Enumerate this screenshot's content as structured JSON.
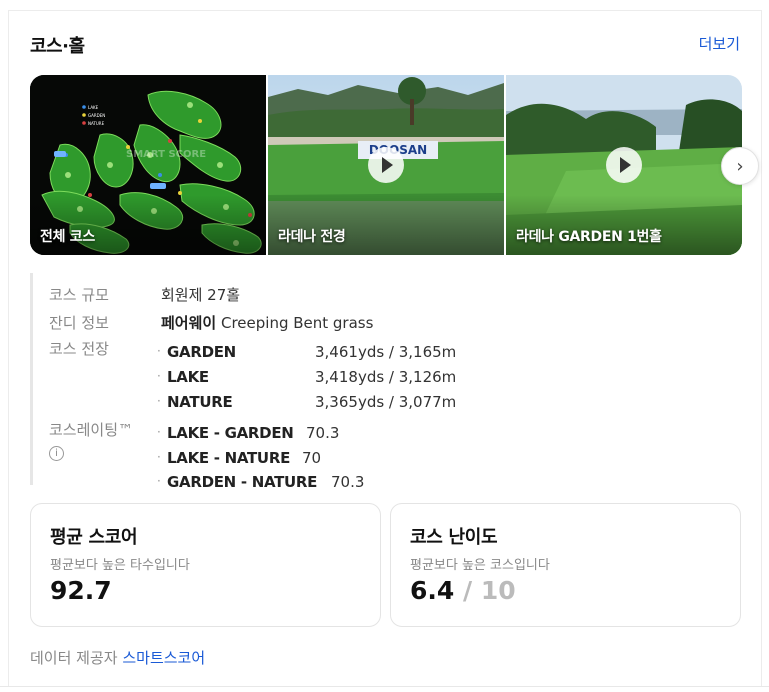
{
  "header": {
    "title": "코스·홀",
    "more_label": "더보기"
  },
  "media": [
    {
      "label": "전체 코스",
      "type": "map",
      "map_labels": [
        "LAKE",
        "GARDEN",
        "NATURE",
        "SMART SCORE"
      ]
    },
    {
      "label": "라데나 전경",
      "type": "video",
      "sign_text": "DOOSAN"
    },
    {
      "label": "라데나 GARDEN 1번홀",
      "type": "video"
    }
  ],
  "info": {
    "size_label": "코스 규모",
    "size_value": "회원제 27홀",
    "grass_label": "잔디 정보",
    "grass_bold": "페어웨이",
    "grass_value": "Creeping Bent grass",
    "length_label": "코스 전장",
    "lengths": [
      {
        "name": "GARDEN",
        "value": "3,461yds / 3,165m"
      },
      {
        "name": "LAKE",
        "value": "3,418yds / 3,126m"
      },
      {
        "name": "NATURE",
        "value": "3,365yds / 3,077m"
      }
    ],
    "rating_label": "코스레이팅™",
    "rating_info_icon": "i",
    "ratings": [
      {
        "name": "LAKE - GARDEN",
        "value": "70.3"
      },
      {
        "name": "LAKE - NATURE",
        "value": "70"
      },
      {
        "name": "GARDEN - NATURE",
        "value": "70.3"
      }
    ]
  },
  "stats": {
    "avg": {
      "title": "평균 스코어",
      "sub": "평균보다 높은 타수입니다",
      "value": "92.7"
    },
    "difficulty": {
      "title": "코스 난이도",
      "sub": "평균보다 높은 코스입니다",
      "value": "6.4",
      "max": "/ 10"
    }
  },
  "footer": {
    "prefix": "데이터 제공자",
    "provider": "스마트스코어"
  },
  "colors": {
    "link": "#1a5ad6",
    "accent_green": "#3fae3a"
  }
}
